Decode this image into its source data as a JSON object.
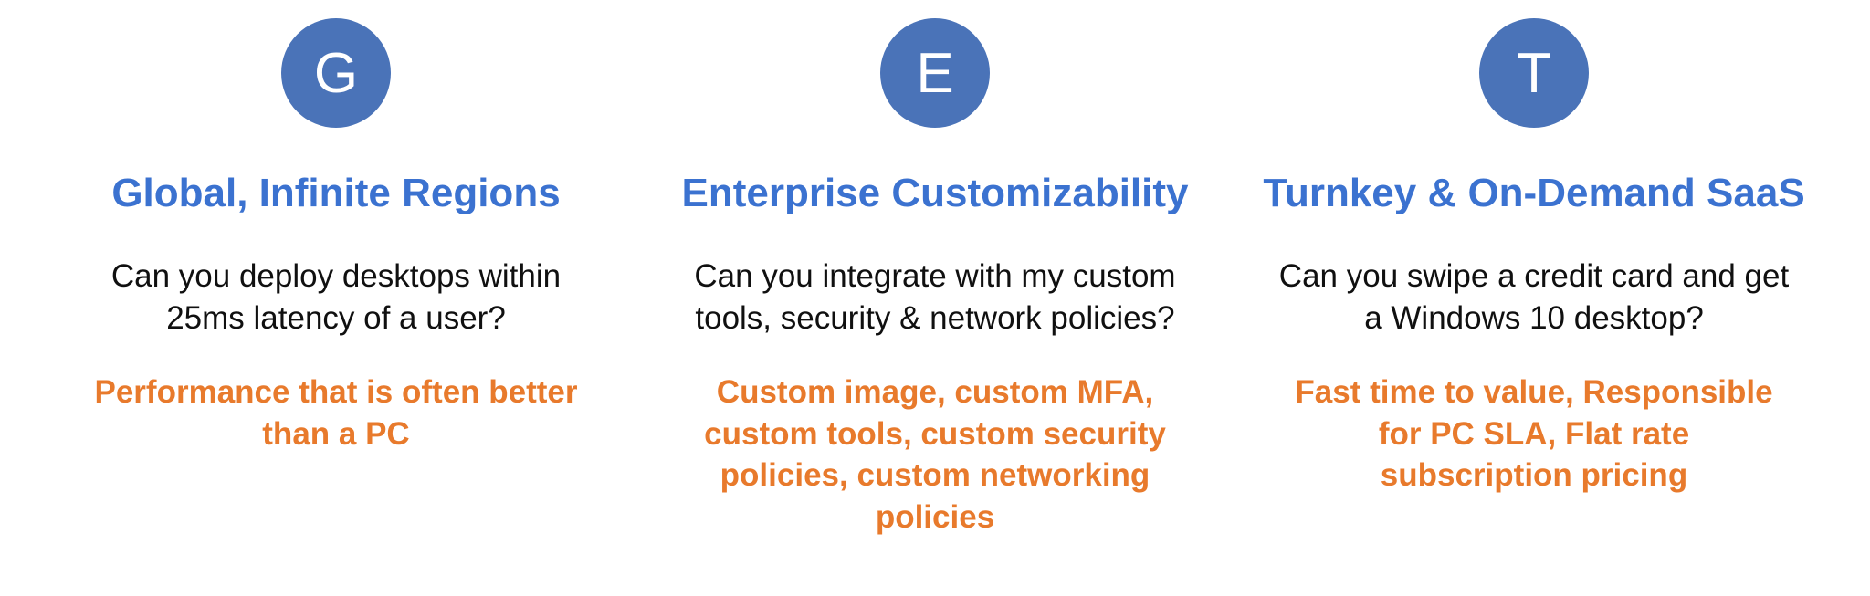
{
  "colors": {
    "accent_blue": "#3B72D0",
    "badge_blue": "#4A73B8",
    "orange": "#E87A2C"
  },
  "columns": [
    {
      "letter": "G",
      "title": "Global, Infinite Regions",
      "question": "Can you deploy desktops within 25ms latency of a user?",
      "answer": "Performance that is often better than a PC"
    },
    {
      "letter": "E",
      "title": "Enterprise Customizability",
      "question": "Can you integrate with my custom tools, security & network policies?",
      "answer": "Custom image, custom MFA, custom tools, custom security policies, custom networking policies"
    },
    {
      "letter": "T",
      "title": "Turnkey & On-Demand SaaS",
      "question": "Can you swipe a credit card and get a Windows 10 desktop?",
      "answer": "Fast time to value, Responsible for PC SLA, Flat rate subscription pricing"
    }
  ]
}
